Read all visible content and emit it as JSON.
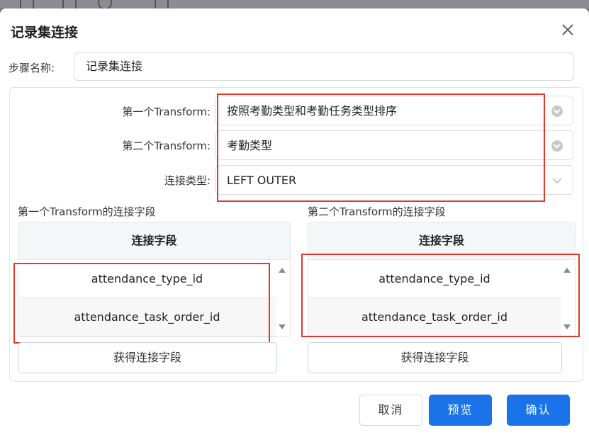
{
  "dialog": {
    "title": "记录集连接"
  },
  "step_name": {
    "label": "步骤名称:",
    "value": "记录集连接"
  },
  "form": {
    "first_transform": {
      "label": "第一个Transform:",
      "value": "按照考勤类型和考勤任务类型排序"
    },
    "second_transform": {
      "label": "第二个Transform:",
      "value": "考勤类型"
    },
    "join_type": {
      "label": "连接类型:",
      "value": "LEFT OUTER"
    }
  },
  "left_grid": {
    "section_label": "第一个Transform的连接字段",
    "header": "连接字段",
    "rows": [
      "attendance_type_id",
      "attendance_task_order_id"
    ],
    "button": "获得连接字段"
  },
  "right_grid": {
    "section_label": "第二个Transform的连接字段",
    "header": "连接字段",
    "rows": [
      "attendance_type_id",
      "attendance_task_order_id"
    ],
    "button": "获得连接字段"
  },
  "footer": {
    "cancel": "取消",
    "preview": "预览",
    "confirm": "确认"
  },
  "colors": {
    "primary": "#1a73e8",
    "highlight": "#e0392b"
  },
  "icons": [
    "close-icon",
    "clear-icon",
    "chevron-down-icon",
    "scroll-up-icon",
    "scroll-down-icon"
  ]
}
